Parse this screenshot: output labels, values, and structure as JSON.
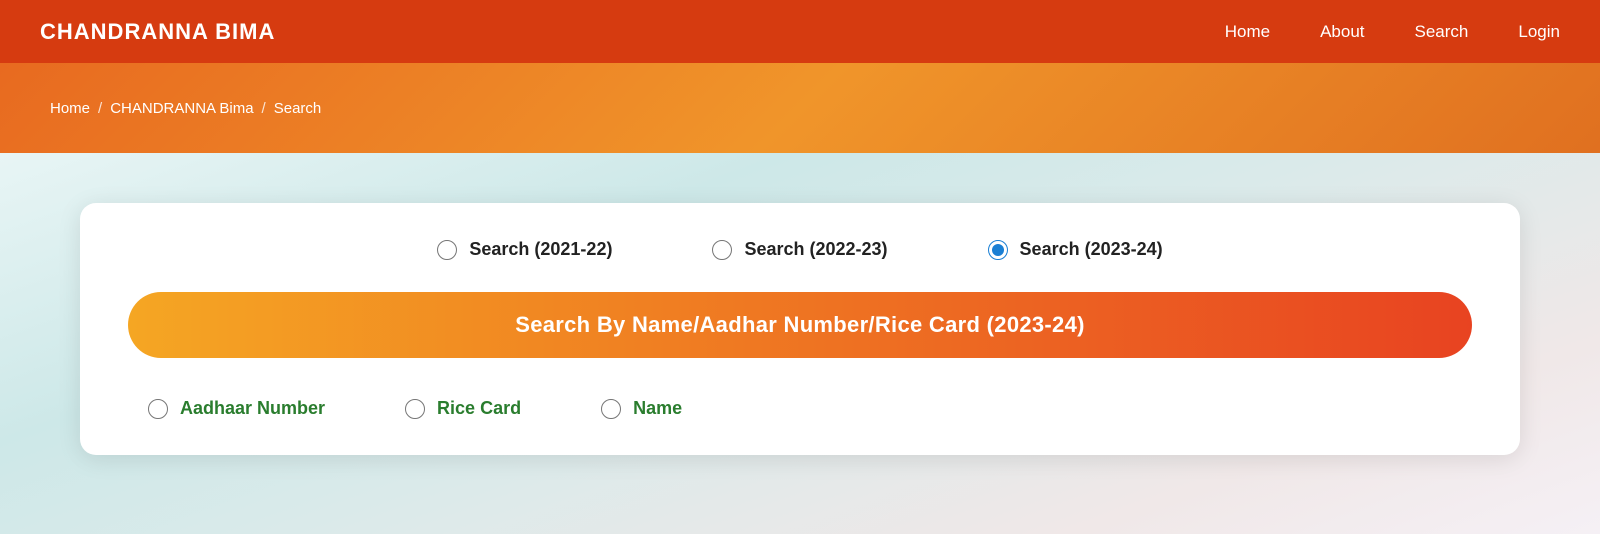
{
  "navbar": {
    "brand": "CHANDRANNA BIMA",
    "links": [
      {
        "label": "Home",
        "href": "#"
      },
      {
        "label": "About",
        "href": "#"
      },
      {
        "label": "Search",
        "href": "#"
      },
      {
        "label": "Login",
        "href": "#"
      }
    ]
  },
  "breadcrumb": {
    "items": [
      {
        "label": "Home"
      },
      {
        "separator": "/"
      },
      {
        "label": "CHANDRANNA Bima"
      },
      {
        "separator": "/"
      },
      {
        "label": "Search"
      }
    ]
  },
  "search_card": {
    "year_options": [
      {
        "id": "y2021",
        "label": "Search (2021-22)",
        "checked": false
      },
      {
        "id": "y2022",
        "label": "Search (2022-23)",
        "checked": false
      },
      {
        "id": "y2023",
        "label": "Search (2023-24)",
        "checked": true
      }
    ],
    "banner_text": "Search By Name/Aadhar Number/Rice Card (2023-24)",
    "search_type_options": [
      {
        "id": "aadhaar",
        "label": "Aadhaar Number",
        "checked": false
      },
      {
        "id": "ricecard",
        "label": "Rice Card",
        "checked": false
      },
      {
        "id": "name",
        "label": "Name",
        "checked": false
      }
    ]
  }
}
